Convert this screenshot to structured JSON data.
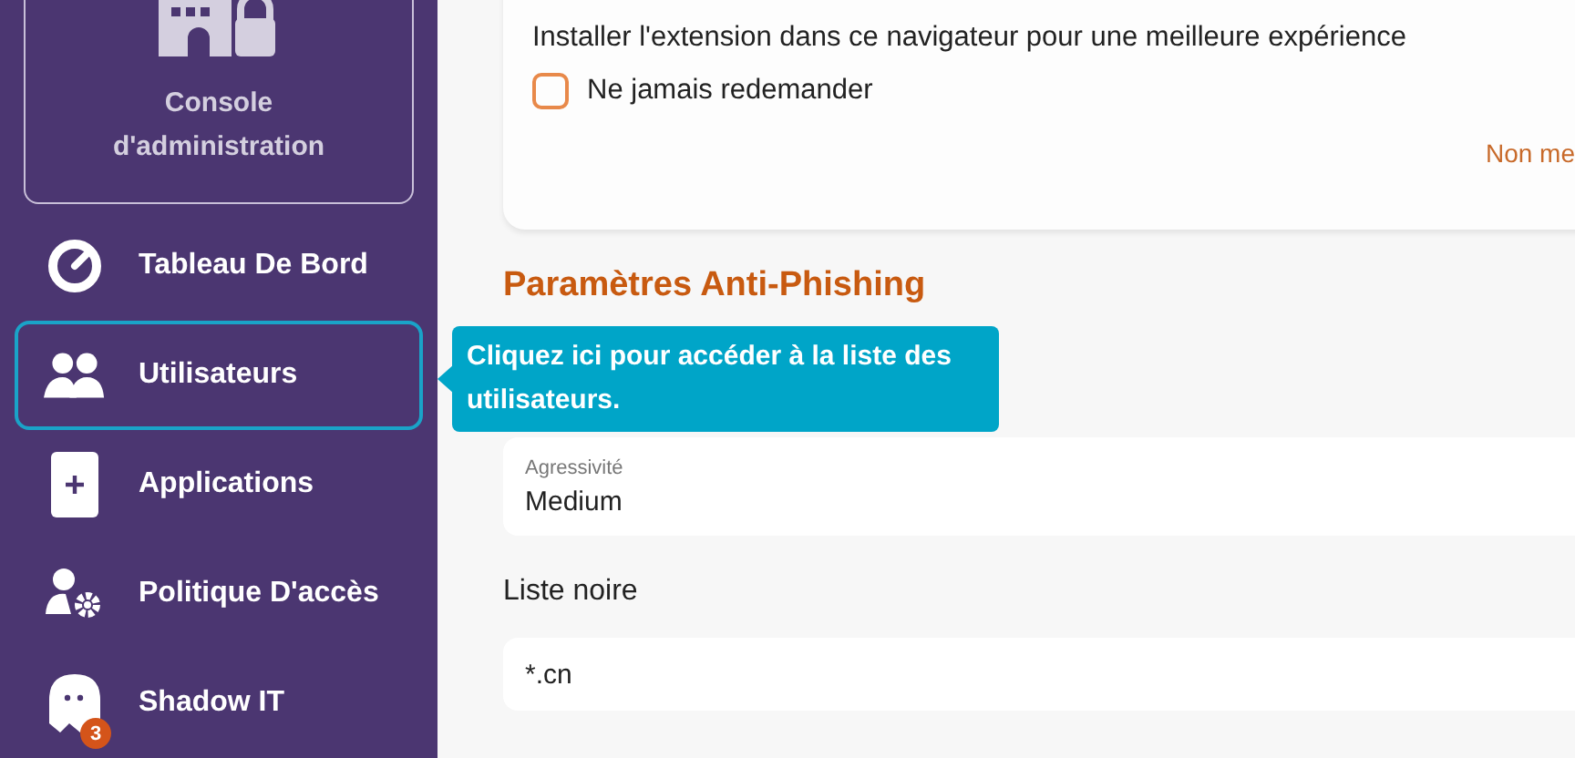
{
  "sidebar": {
    "console": {
      "title": "Console d'administration"
    },
    "items": [
      {
        "label": "Tableau De Bord",
        "kind": "gauge",
        "selected": false
      },
      {
        "label": "Utilisateurs",
        "kind": "users",
        "selected": true
      },
      {
        "label": "Applications",
        "kind": "apps",
        "selected": false
      },
      {
        "label": "Politique D'accès",
        "kind": "policy",
        "selected": false
      },
      {
        "label": "Shadow IT",
        "kind": "ghost",
        "selected": false,
        "badge": "3"
      }
    ]
  },
  "tooltip": {
    "text": "Cliquez ici pour accéder à la liste des utilisateurs."
  },
  "extension_card": {
    "message": "Installer l'extension dans ce navigateur pour une meilleure expérience",
    "checkbox": {
      "label": "Ne jamais redemander",
      "checked": false
    },
    "dismiss": "Non me"
  },
  "anti_phishing": {
    "title": "Paramètres Anti-Phishing",
    "aggressiveness": {
      "label": "Agressivité",
      "value": "Medium"
    },
    "blacklist": {
      "label": "Liste noire",
      "value": "*.cn"
    }
  }
}
